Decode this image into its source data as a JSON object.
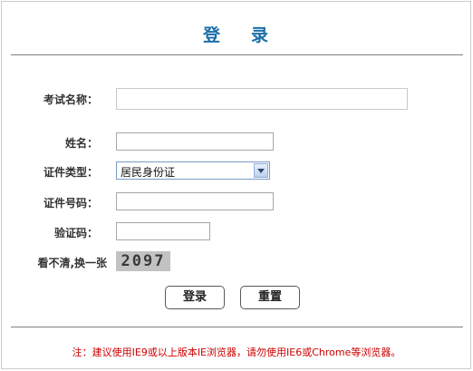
{
  "title": {
    "char1": "登",
    "char2": "录"
  },
  "form": {
    "exam_name_label": "考试名称：",
    "exam_name_value": "",
    "name_label": "姓名：",
    "name_value": "",
    "id_type_label": "证件类型：",
    "id_type_selected": "居民身份证",
    "id_number_label": "证件号码：",
    "id_number_value": "",
    "captcha_label": "验证码：",
    "captcha_value": "",
    "refresh_label": "看不清,换一张",
    "captcha_text": "2097"
  },
  "buttons": {
    "login": "登录",
    "reset": "重置"
  },
  "note": "注：建议使用IE9或以上版本IE浏览器，请勿使用IE6或Chrome等浏览器。",
  "colors": {
    "title": "#1a6ea8",
    "note": "#cc0000",
    "divider": "#7f7f7f"
  }
}
